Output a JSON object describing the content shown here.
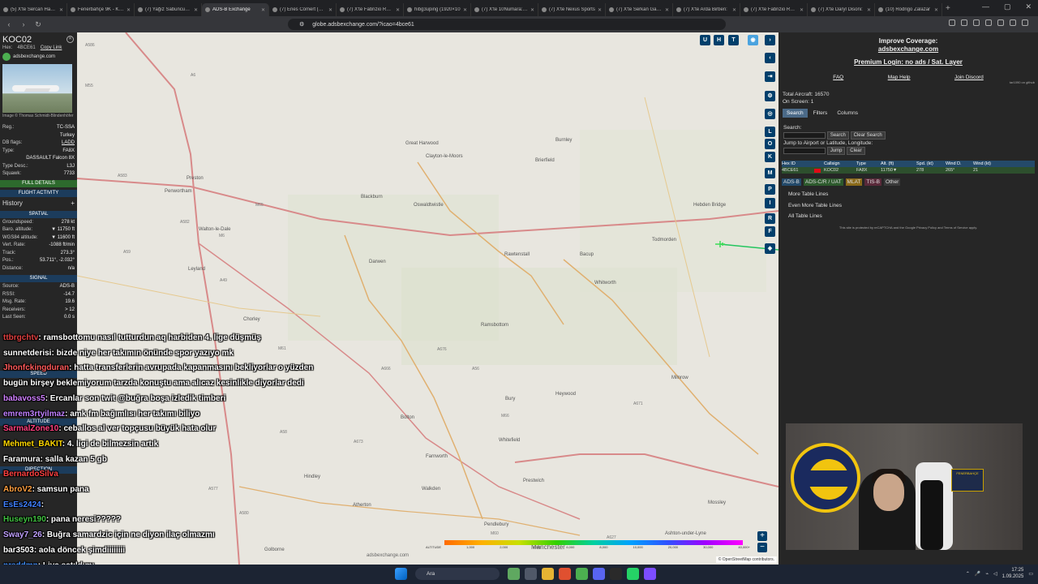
{
  "browser": {
    "tabs": [
      {
        "title": "(5) X'te Sercan Hamza",
        "active": false
      },
      {
        "title": "Fenerbahçe 9K - Kulü",
        "active": false
      },
      {
        "title": "(7) Yağız Sabuncuoğlu",
        "active": false
      },
      {
        "title": "ADS-B Exchange",
        "active": true
      },
      {
        "title": "(7) Enes Cömert (@18",
        "active": false
      },
      {
        "title": "(7) X'te Fabrizio Roma",
        "active": false
      },
      {
        "title": "hibg3uping (1920×10",
        "active": false
      },
      {
        "title": "(7) X'te 10Numara: \"F",
        "active": false
      },
      {
        "title": "(7) X'te Nexus Sports",
        "active": false
      },
      {
        "title": "(7) X'te Serkan Gazio",
        "active": false
      },
      {
        "title": "(7) X'te Arda Birben:",
        "active": false
      },
      {
        "title": "(7) X'te Fabrizio Romano",
        "active": false
      },
      {
        "title": "(7) X'te Daryl Disoni:",
        "active": false
      },
      {
        "title": "(10) Rodrigo Zalazar",
        "active": false
      }
    ],
    "url": "globe.adsbexchange.com/?icao=4bce61"
  },
  "aircraft": {
    "callsign": "KOC02",
    "hex_label": "Hex:",
    "hex": "4BCE61",
    "copy_link": "Copy Link",
    "source_site": "adsbexchange.com",
    "photo_credit": "Image © Thomas Schmidt-Blindenhöfer",
    "reg_label": "Reg.:",
    "reg": "TC-SSA",
    "country": "Turkey",
    "dbflags_label": "DB flags:",
    "dbflags": "LADD",
    "type_label": "Type:",
    "type": "FA8X",
    "model": "DASSAULT Falcon 8X",
    "typedesc_label": "Type Desc.:",
    "typedesc": "L3J",
    "squawk_label": "Squawk:",
    "squawk": "7733",
    "full_details": "FULL DETAILS",
    "flight_activity": "FLIGHT ACTIVITY",
    "history": "History",
    "spatial": "SPATIAL",
    "groundspeed_label": "Groundspeed:",
    "groundspeed": "278 kt",
    "baro_alt_label": "Baro. altitude:",
    "baro_alt": "▼ 11750 ft",
    "wgs_alt_label": "WGS84 altitude:",
    "wgs_alt": "▼ 11600 ft",
    "vert_rate_label": "Vert. Rate:",
    "vert_rate": "-1088 ft/min",
    "track_label": "Track:",
    "track": "273.3°",
    "pos_label": "Pos.:",
    "pos": "53.711°, -2.032°",
    "distance_label": "Distance:",
    "distance": "n/a",
    "signal": "SIGNAL",
    "source_label": "Source:",
    "source": "ADS-B",
    "rssi_label": "RSSI:",
    "rssi": "-14.7",
    "msgrate_label": "Msg. Rate:",
    "msgrate": "19.6",
    "receivers_label": "Receivers:",
    "receivers": "> 12",
    "lastseen_label": "Last Seen:",
    "lastseen": "0.0 s",
    "speed_hdr": "SPEED",
    "altitude_hdr": "ALTITUDE",
    "direction_hdr": "DIRECTION"
  },
  "map": {
    "towns": [
      {
        "name": "Preston"
      },
      {
        "name": "Penwortham"
      },
      {
        "name": "Great Harwood"
      },
      {
        "name": "Clayton-le-Moors"
      },
      {
        "name": "Oswaldtwistle"
      },
      {
        "name": "Blackburn"
      },
      {
        "name": "Burnley"
      },
      {
        "name": "Darwen"
      },
      {
        "name": "Rawtenstall"
      },
      {
        "name": "Bacup"
      },
      {
        "name": "Todmorden"
      },
      {
        "name": "Hebden Bridge"
      },
      {
        "name": "Leyland"
      },
      {
        "name": "Chorley"
      },
      {
        "name": "Whitworth"
      },
      {
        "name": "Ramsbottom"
      },
      {
        "name": "Milnrow"
      },
      {
        "name": "Bury"
      },
      {
        "name": "Heywood"
      },
      {
        "name": "Bolton"
      },
      {
        "name": "Whitefield"
      },
      {
        "name": "Prestwich"
      },
      {
        "name": "Farnworth"
      },
      {
        "name": "Walkden"
      },
      {
        "name": "Atherton"
      },
      {
        "name": "Hindley"
      },
      {
        "name": "Golborne"
      },
      {
        "name": "Pendlebury"
      },
      {
        "name": "Manchester"
      },
      {
        "name": "Mossley"
      },
      {
        "name": "Ashton-under-Lyne"
      },
      {
        "name": "Brierfield"
      },
      {
        "name": "Walton-le-Dale"
      }
    ],
    "roads": [
      "A586",
      "A6",
      "M55",
      "A583",
      "M6",
      "A59",
      "M65",
      "A582",
      "A49",
      "M61",
      "A666",
      "A676",
      "A56",
      "M66",
      "A58",
      "A579",
      "A673",
      "M60",
      "A577",
      "A580",
      "A627",
      "A671"
    ],
    "top_buttons": [
      "U",
      "H",
      "T"
    ],
    "side_buttons": [
      "L",
      "O",
      "K",
      "M",
      "P",
      "I",
      "R",
      "F"
    ],
    "alt_ticks": [
      "ALTITUDE",
      "1,000",
      "2,000",
      "4,000",
      "6,000",
      "8,000",
      "10,000",
      "20,000",
      "30,000",
      "40,000+"
    ],
    "watermark": "adsbexchange.com",
    "attribution": "© OpenStreetMap contributors."
  },
  "panel": {
    "improve": "Improve Coverage:",
    "improve_link": "adsbexchange.com",
    "premium": "Premium Login: no ads / Sat. Layer",
    "faq": "FAQ",
    "maphelp": "Map Help",
    "discord": "Join Discord",
    "github": "tar1090 on github",
    "total_label": "Total Aircraft:",
    "total": "16570",
    "onscreen_label": "On Screen:",
    "onscreen": "1",
    "tabs": [
      "Search",
      "Filters",
      "Columns"
    ],
    "search_label": "Search:",
    "search_btn": "Search",
    "clear_search": "Clear Search",
    "jump_label": "Jump to Airport or Latitude, Longitude:",
    "jump_btn": "Jump",
    "clear_btn": "Clear",
    "columns": [
      "Hex ID",
      "",
      "Callsign",
      "Type",
      "Alt. (ft)",
      "Spd. (kt)",
      "Wind D.",
      "Wind (kt)"
    ],
    "row": [
      "4BCE61",
      "",
      "KOC02",
      "FA8X",
      "11750▼",
      "278",
      "265°",
      "21"
    ],
    "src_badges": [
      "ADS-B",
      "ADS-C/R / UAT",
      "MLAT",
      "TIS-B",
      "Other"
    ],
    "options": [
      "More Table Lines",
      "Even More Table Lines",
      "All Table Lines"
    ],
    "recaptcha": "This site is protected by reCAPTCHA and the Google Privacy Policy and Terms of Service apply."
  },
  "chat": [
    {
      "user": "ttbrgchtv",
      "color": "#e04040",
      "text": ": ramsbottomu nasıl tutturdun aq harbiden 4. lige düşmüş"
    },
    {
      "user": "sunnetderisi",
      "color": "#ffffff",
      "text": ": bizde niye her takımın önünde spor yazıyo mk"
    },
    {
      "user": "Jhonfckingduran",
      "color": "#ff5a5a",
      "text": ": hatta transferlerin avrupada kapanmasını bekliyorlar o yüzden"
    },
    {
      "user": "",
      "color": "#ffffff",
      "text": "bugün birşey beklemiyorum tarzda konuştu ama alıcaz kesinlikle diyorlar dedi"
    },
    {
      "user": "babavoss5",
      "color": "#d080ff",
      "text": ": Ercanlar son twit @buğra boşa izledik timberi"
    },
    {
      "user": "emrem3rtyilmaz",
      "color": "#c080ff",
      "text": ": amk fm bağımlısı her takımı biliyo"
    },
    {
      "user": "SarmalZone10",
      "color": "#ff4080",
      "text": ": ceballos al ver topçusu büyük hata olur"
    },
    {
      "user": "Mehmet_BAKIT",
      "color": "#ffd700",
      "text": ": 4. ligi de bilmezsin artık"
    },
    {
      "user": "Faramura",
      "color": "#ffffff",
      "text": ": salla kazan 5 gb"
    },
    {
      "user": "BernardoSilva",
      "color": "#ff4040",
      "text": ""
    },
    {
      "user": "AbroV2",
      "color": "#ffa040",
      "text": ": samsun pana"
    },
    {
      "user": "EsEs2424",
      "color": "#4080ff",
      "text": ":"
    },
    {
      "user": "Huseyn190",
      "color": "#40c040",
      "text": ": pana neresi?????"
    },
    {
      "user": "Sway7_26",
      "color": "#c0a0ff",
      "text": ": Buğra samardzic için ne diyon ilaç olmazmı"
    },
    {
      "user": "bar3503",
      "color": "#ffffff",
      "text": ": aola döncek şimdiiiiiiii"
    },
    {
      "user": "nrsddmn",
      "color": "#4090ff",
      "text": ": Liva satıldımı"
    }
  ],
  "taskbar": {
    "search": "Ara",
    "time": "17:25",
    "date": "1.09.2025"
  }
}
